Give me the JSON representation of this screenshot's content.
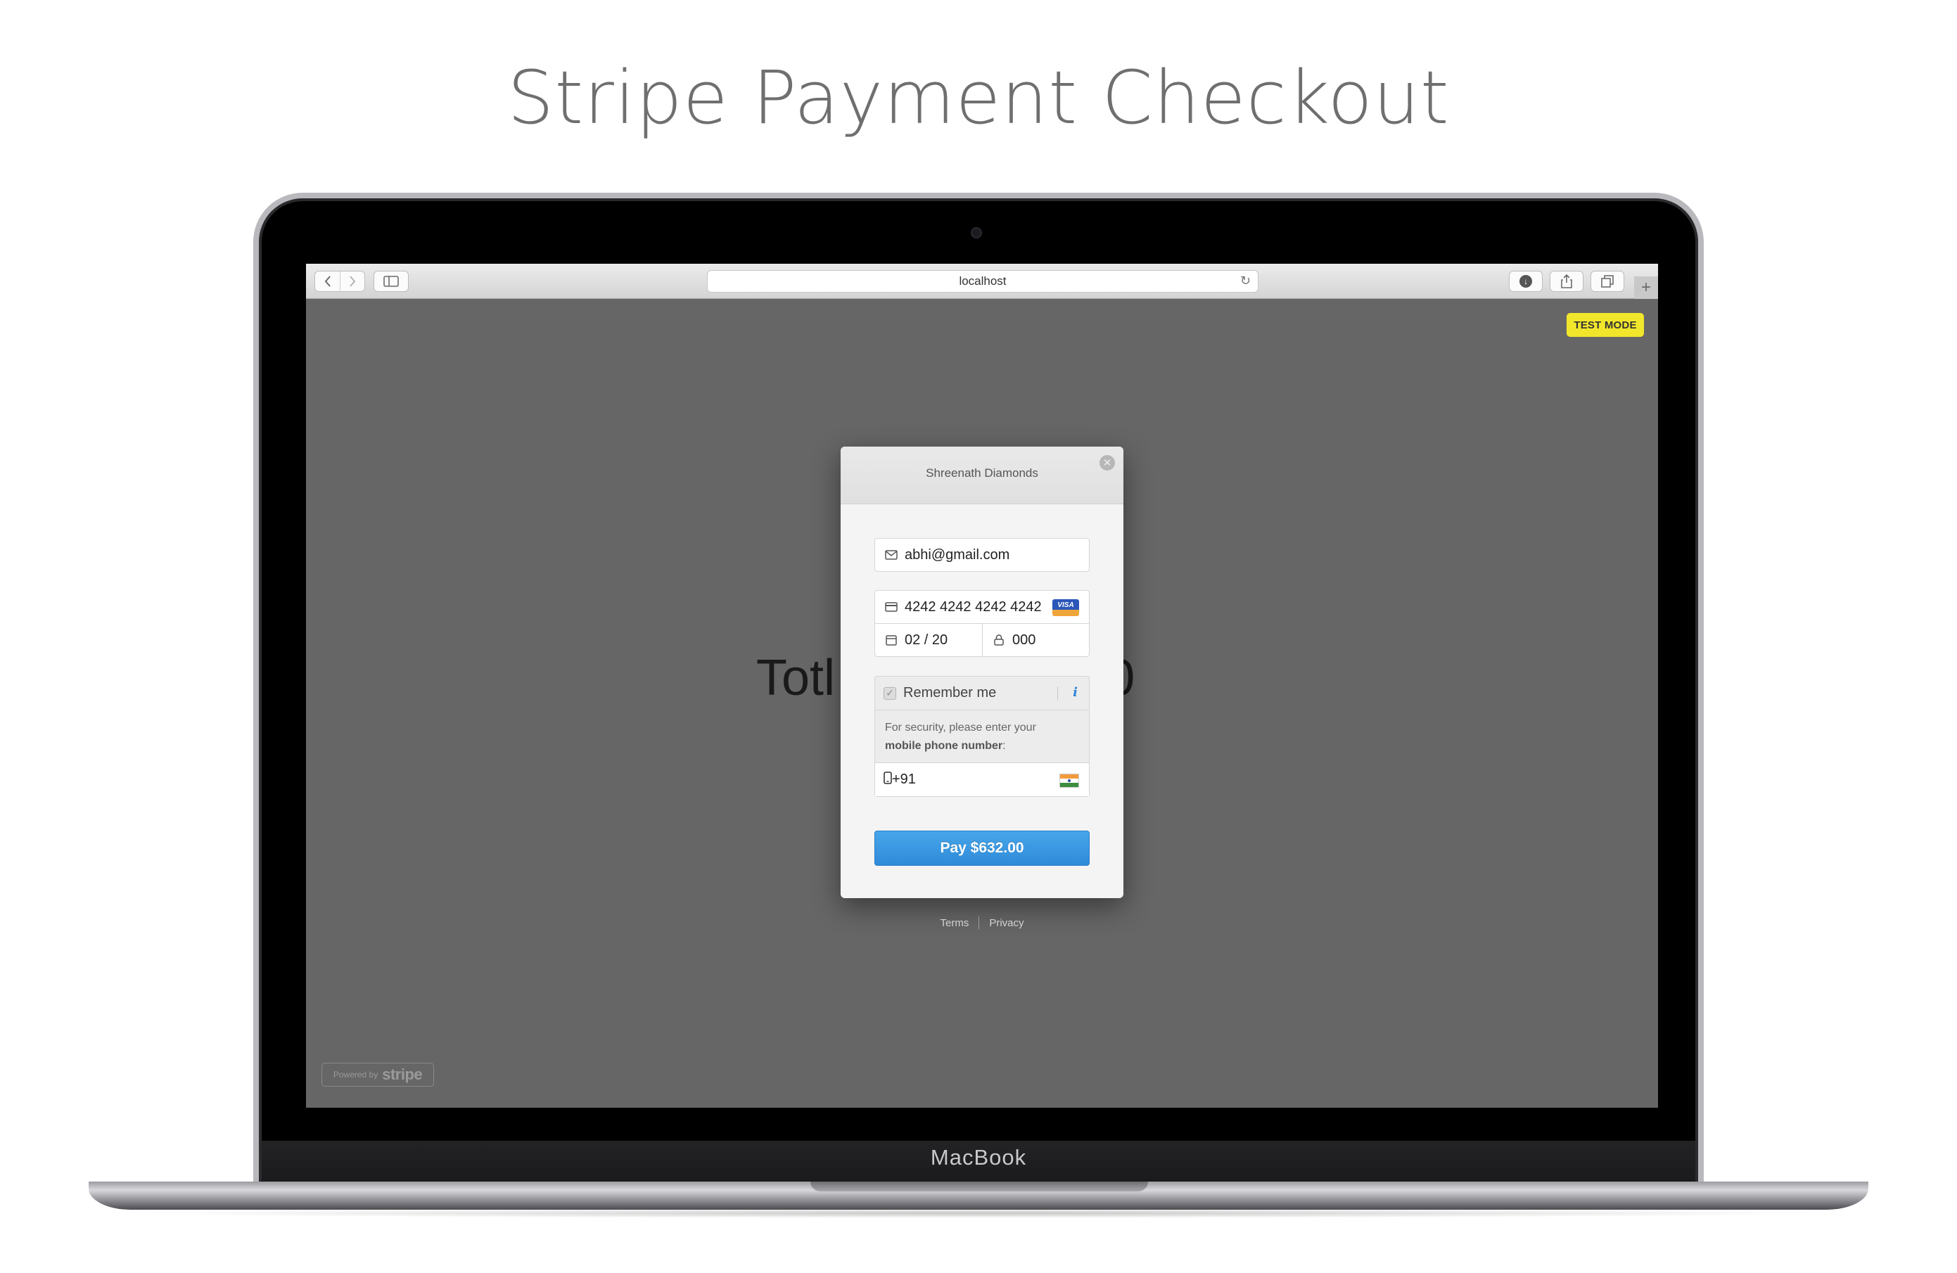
{
  "page": {
    "title": "Stripe Payment Checkout"
  },
  "device": {
    "brand_label": "MacBook"
  },
  "browser": {
    "address": "localhost",
    "icons": {
      "back": "chevron-left-icon",
      "forward": "chevron-right-icon",
      "sidebar": "sidebar-icon",
      "reload": "reload-icon",
      "downloads": "download-icon",
      "share": "share-icon",
      "tabs": "tabs-overview-icon",
      "new_tab": "plus-icon"
    }
  },
  "webpage": {
    "test_mode_badge": "TEST MODE",
    "background_total_left": "Totl",
    "background_total_right": "200",
    "powered_by_prefix": "Powered by",
    "powered_by_brand": "stripe"
  },
  "checkout": {
    "merchant_name": "Shreenath Diamonds",
    "email": "abhi@gmail.com",
    "card_number": "4242 4242 4242 4242",
    "card_brand": "VISA",
    "expiry": "02 / 20",
    "cvc": "000",
    "remember_me_label": "Remember me",
    "remember_me_checked": true,
    "info_glyph": "i",
    "security_note_prefix": "For security, please enter your",
    "security_note_bold": "mobile phone number",
    "security_note_suffix": ":",
    "phone_value": "+91",
    "phone_country": "India",
    "pay_button_label": "Pay $632.00",
    "terms_label": "Terms",
    "privacy_label": "Privacy"
  },
  "colors": {
    "pay_button": "#3b97e2",
    "test_mode": "#f2e62c",
    "overlay": "#666666",
    "info_icon": "#2e84d6"
  }
}
